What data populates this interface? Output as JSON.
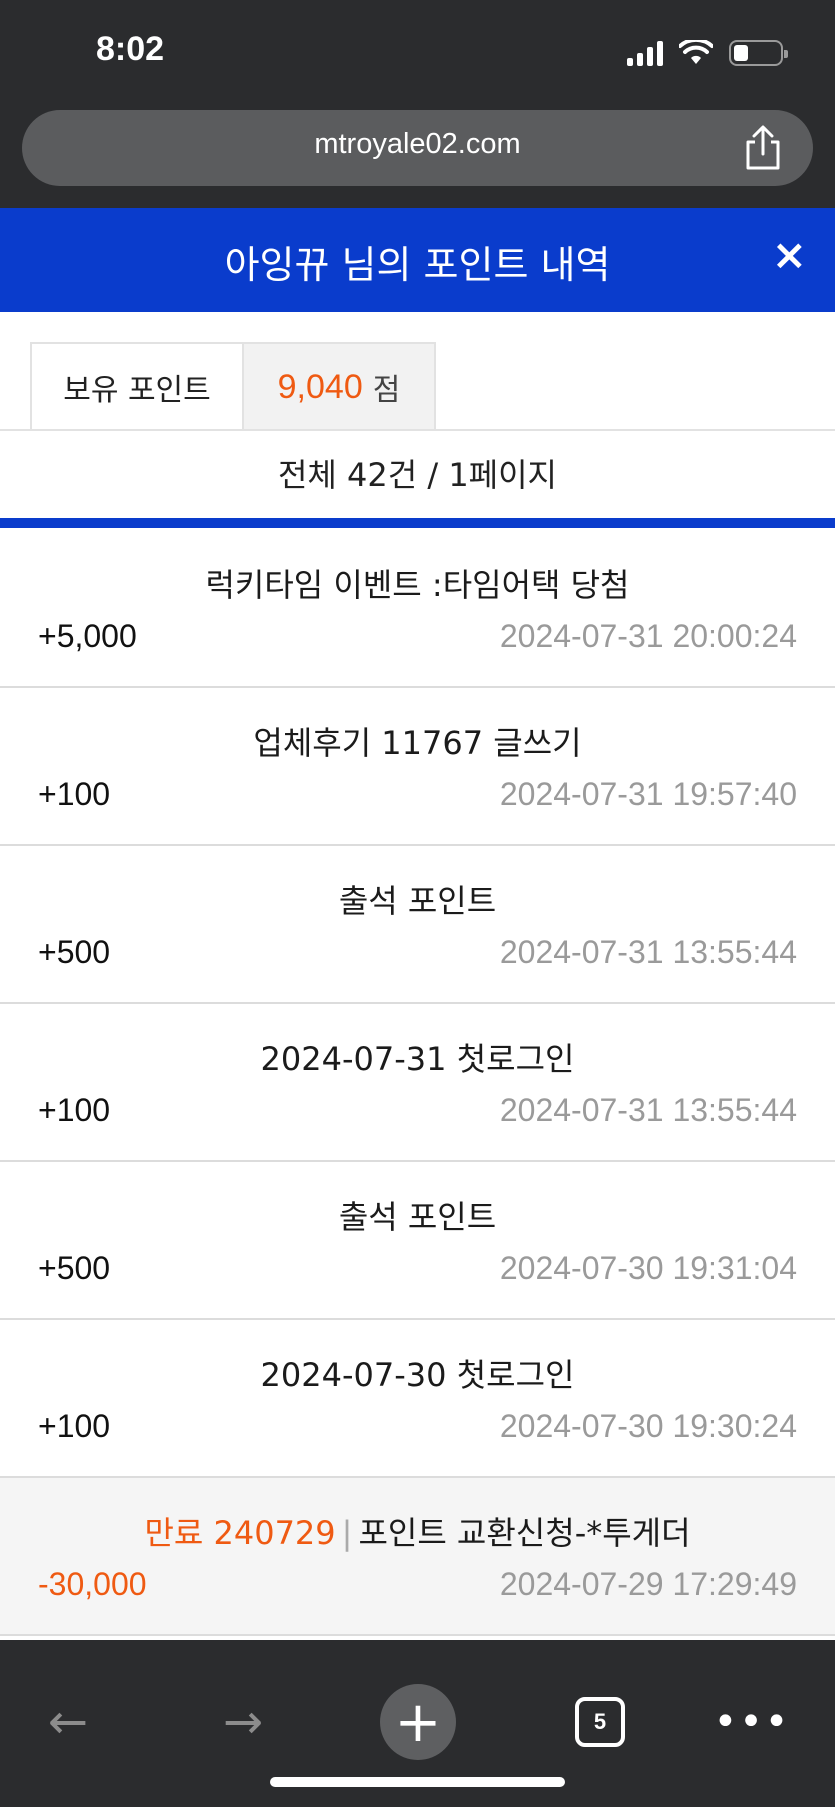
{
  "status_bar": {
    "time": "8:02"
  },
  "browser": {
    "url": "mtroyale02.com"
  },
  "header": {
    "title": "아잉뀨 님의 포인트 내역",
    "close": "×"
  },
  "points": {
    "label": "보유 포인트",
    "value": "9,040",
    "unit": "점"
  },
  "summary": "전체 42건 / 1페이지",
  "rows": [
    {
      "title": "럭키타임 이벤트 :타임어택 당첨",
      "amount": "+5,000",
      "datetime": "2024-07-31 20:00:24"
    },
    {
      "title": "업체후기 11767 글쓰기",
      "amount": "+100",
      "datetime": "2024-07-31 19:57:40"
    },
    {
      "title": "출석 포인트",
      "amount": "+500",
      "datetime": "2024-07-31 13:55:44"
    },
    {
      "title": "2024-07-31 첫로그인",
      "amount": "+100",
      "datetime": "2024-07-31 13:55:44"
    },
    {
      "title": "출석 포인트",
      "amount": "+500",
      "datetime": "2024-07-30 19:31:04"
    },
    {
      "title": "2024-07-30 첫로그인",
      "amount": "+100",
      "datetime": "2024-07-30 19:30:24"
    },
    {
      "expired_label": "만료 240729",
      "separator": "|",
      "title": "포인트 교환신청-*투게더",
      "amount": "-30,000",
      "datetime": "2024-07-29 17:29:49"
    }
  ],
  "toolbar": {
    "back": "←",
    "forward": "→",
    "new_tab": "+",
    "tab_count": "5",
    "more": "•••"
  },
  "colors": {
    "header_blue": "#0a3ccc",
    "accent_orange": "#ef5a12",
    "chrome_dark": "#2b2c2e"
  }
}
